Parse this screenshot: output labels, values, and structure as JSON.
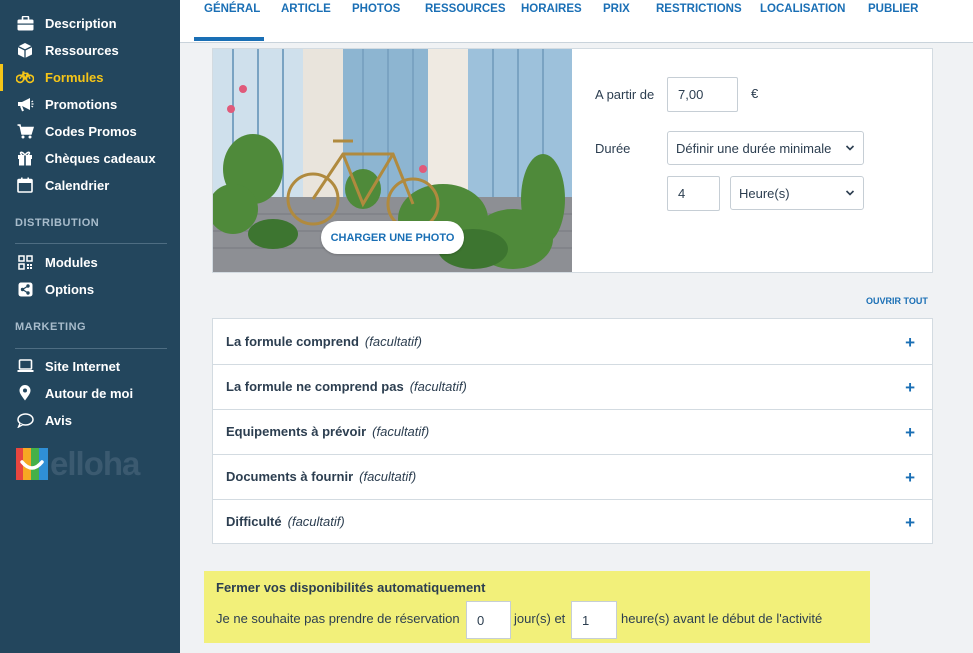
{
  "sidebar": {
    "items": [
      {
        "label": "Description",
        "icon": "briefcase-icon"
      },
      {
        "label": "Ressources",
        "icon": "cube-icon"
      },
      {
        "label": "Formules",
        "icon": "bicycle-icon",
        "active": true
      },
      {
        "label": "Promotions",
        "icon": "megaphone-icon"
      },
      {
        "label": "Codes Promos",
        "icon": "cart-icon"
      },
      {
        "label": "Chèques cadeaux",
        "icon": "gift-icon"
      },
      {
        "label": "Calendrier",
        "icon": "calendar-icon"
      }
    ],
    "section_distribution": "DISTRIBUTION",
    "distribution_items": [
      {
        "label": "Modules",
        "icon": "qr-code-icon"
      },
      {
        "label": "Options",
        "icon": "share-icon"
      }
    ],
    "section_marketing": "MARKETING",
    "marketing_items": [
      {
        "label": "Site Internet",
        "icon": "laptop-icon"
      },
      {
        "label": "Autour de moi",
        "icon": "map-pin-icon"
      },
      {
        "label": "Avis",
        "icon": "speech-bubble-icon"
      }
    ],
    "logo_text": "elloha",
    "accent_color": "#f5c518",
    "background_color": "#23465d"
  },
  "tabs": [
    "GÉNÉRAL",
    "ARTICLE",
    "PHOTOS",
    "RESSOURCES",
    "HORAIRES",
    "PRIX",
    "RESTRICTIONS",
    "LOCALISATION",
    "PUBLIER"
  ],
  "active_tab": "GÉNÉRAL",
  "photo_card": {
    "upload_label": "CHARGER UNE PHOTO"
  },
  "pricing": {
    "from_label": "A partir de",
    "price_value": "7,00",
    "currency": "€",
    "duration_label": "Durée",
    "duration_mode": "Définir une durée minimale",
    "duration_value": "4",
    "duration_unit": "Heure(s)"
  },
  "accordion": {
    "open_all_label": "OUVRIR TOUT",
    "optional_label": "(facultatif)",
    "rows": [
      {
        "title": "La formule comprend"
      },
      {
        "title": "La formule ne comprend pas"
      },
      {
        "title": "Equipements à prévoir"
      },
      {
        "title": "Documents à fournir"
      },
      {
        "title": "Difficulté"
      }
    ]
  },
  "auto_close": {
    "title": "Fermer vos disponibilités automatiquement",
    "text_before": "Je ne souhaite pas prendre de réservation",
    "days_value": "0",
    "days_label": "jour(s) et",
    "hours_value": "1",
    "hours_label": "heure(s) avant le début de l'activité",
    "highlight_color": "#f2f07a"
  }
}
